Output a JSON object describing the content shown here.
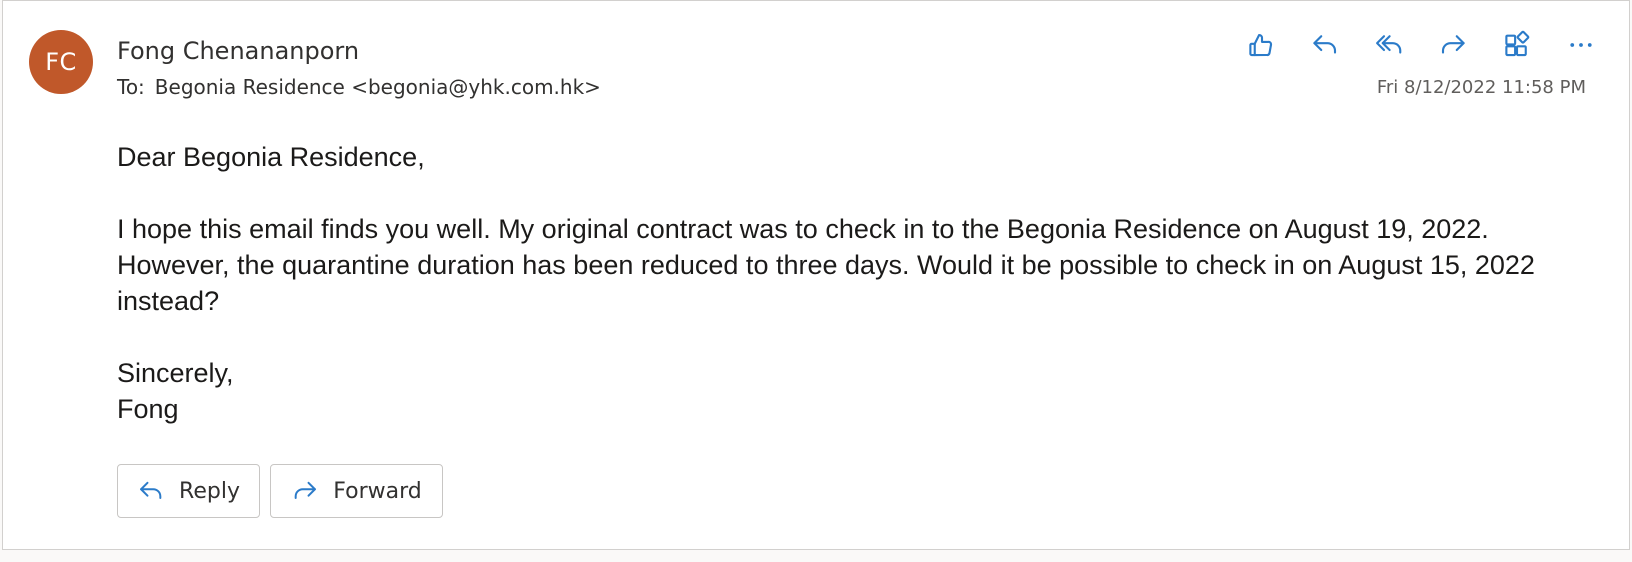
{
  "message": {
    "avatar_initials": "FC",
    "avatar_color": "#c0582a",
    "sender_name": "Fong Chenananporn",
    "to_label": "To:",
    "recipient": "Begonia Residence <begonia@yhk.com.hk>",
    "date": "Fri 8/12/2022 11:58 PM",
    "body": {
      "greeting": "Dear Begonia Residence,",
      "paragraph": "I hope this email finds you well. My original contract was to check in to the Begonia Residence on August 19, 2022. However, the quarantine duration has been reduced to three days. Would it be possible to check in on August 15, 2022 instead?",
      "closing": "Sincerely,",
      "signature": "Fong"
    }
  },
  "toolbar": {
    "items": [
      {
        "icon": "thumbs-up-icon"
      },
      {
        "icon": "reply-icon"
      },
      {
        "icon": "reply-all-icon"
      },
      {
        "icon": "forward-icon"
      },
      {
        "icon": "apps-icon"
      },
      {
        "icon": "more-icon"
      }
    ],
    "accent_color": "#2b7bc9"
  },
  "footer": {
    "reply_label": "Reply",
    "forward_label": "Forward"
  }
}
